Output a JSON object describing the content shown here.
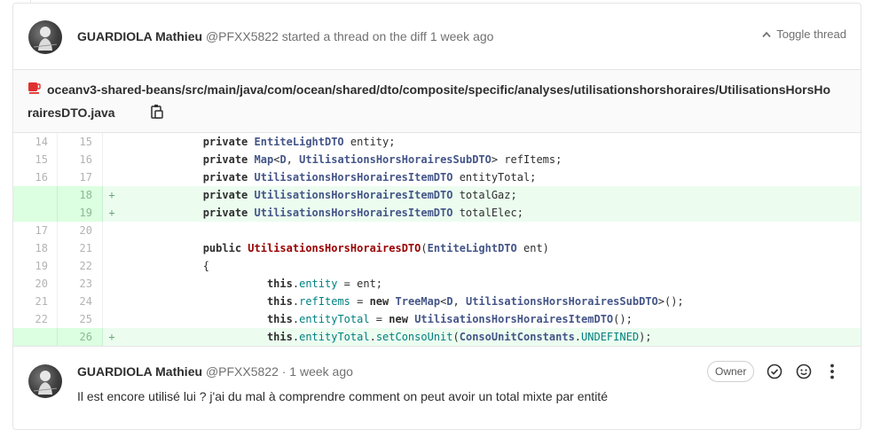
{
  "thread": {
    "author": "GUARDIOLA Mathieu",
    "handle": "@PFXX5822",
    "action_text": "started a thread on the diff 1 week ago",
    "toggle_label": "Toggle thread"
  },
  "file": {
    "path": "oceanv3-shared-beans/src/main/java/com/ocean/shared/dto/composite/specific/analyses/utilisationshorshoraires/UtilisationsHorsHorairesDTO.java",
    "icon": "java-file-icon",
    "copy_icon": "copy-to-clipboard-icon"
  },
  "diff_lines": [
    {
      "old": "14",
      "new": "15",
      "type": "context",
      "marker": ""
    },
    {
      "old": "15",
      "new": "16",
      "type": "context",
      "marker": ""
    },
    {
      "old": "16",
      "new": "17",
      "type": "context",
      "marker": ""
    },
    {
      "old": "",
      "new": "18",
      "type": "added",
      "marker": "+"
    },
    {
      "old": "",
      "new": "19",
      "type": "added",
      "marker": "+"
    },
    {
      "old": "17",
      "new": "20",
      "type": "context",
      "marker": ""
    },
    {
      "old": "18",
      "new": "21",
      "type": "context",
      "marker": ""
    },
    {
      "old": "19",
      "new": "22",
      "type": "context",
      "marker": ""
    },
    {
      "old": "20",
      "new": "23",
      "type": "context",
      "marker": ""
    },
    {
      "old": "21",
      "new": "24",
      "type": "context",
      "marker": ""
    },
    {
      "old": "22",
      "new": "25",
      "type": "context",
      "marker": ""
    },
    {
      "old": "",
      "new": "26",
      "type": "added",
      "marker": "+"
    }
  ],
  "code": [
    [
      [
        "            ",
        ""
      ],
      [
        "private",
        "kw"
      ],
      [
        " ",
        ""
      ],
      [
        "EntiteLightDTO",
        "ty"
      ],
      [
        " entity;",
        ""
      ]
    ],
    [
      [
        "            ",
        ""
      ],
      [
        "private",
        "kw"
      ],
      [
        " ",
        ""
      ],
      [
        "Map",
        "ty"
      ],
      [
        "<",
        ""
      ],
      [
        "D",
        "ty"
      ],
      [
        ", ",
        ""
      ],
      [
        "UtilisationsHorsHorairesSubDTO",
        "ty"
      ],
      [
        "> refItems;",
        ""
      ]
    ],
    [
      [
        "            ",
        ""
      ],
      [
        "private",
        "kw"
      ],
      [
        " ",
        ""
      ],
      [
        "UtilisationsHorsHorairesItemDTO",
        "ty"
      ],
      [
        " entityTotal;",
        ""
      ]
    ],
    [
      [
        "            ",
        ""
      ],
      [
        "private",
        "kw"
      ],
      [
        " ",
        ""
      ],
      [
        "UtilisationsHorsHorairesItemDTO",
        "ty"
      ],
      [
        " totalGaz;",
        ""
      ]
    ],
    [
      [
        "            ",
        ""
      ],
      [
        "private",
        "kw"
      ],
      [
        " ",
        ""
      ],
      [
        "UtilisationsHorsHorairesItemDTO",
        "ty"
      ],
      [
        " totalElec;",
        ""
      ]
    ],
    [
      [
        "",
        ""
      ]
    ],
    [
      [
        "            ",
        ""
      ],
      [
        "public",
        "kw"
      ],
      [
        " ",
        ""
      ],
      [
        "UtilisationsHorsHorairesDTO",
        "fn"
      ],
      [
        "(",
        ""
      ],
      [
        "EntiteLightDTO",
        "ty"
      ],
      [
        " ent)",
        ""
      ]
    ],
    [
      [
        "            {",
        ""
      ]
    ],
    [
      [
        "                      ",
        ""
      ],
      [
        "this",
        "kw"
      ],
      [
        ".",
        ""
      ],
      [
        "entity",
        "pr"
      ],
      [
        " = ent;",
        ""
      ]
    ],
    [
      [
        "                      ",
        ""
      ],
      [
        "this",
        "kw"
      ],
      [
        ".",
        ""
      ],
      [
        "refItems",
        "pr"
      ],
      [
        " = ",
        ""
      ],
      [
        "new",
        "kw"
      ],
      [
        " ",
        ""
      ],
      [
        "TreeMap",
        "ty"
      ],
      [
        "<",
        ""
      ],
      [
        "D",
        "ty"
      ],
      [
        ", ",
        ""
      ],
      [
        "UtilisationsHorsHorairesSubDTO",
        "ty"
      ],
      [
        ">();",
        ""
      ]
    ],
    [
      [
        "                      ",
        ""
      ],
      [
        "this",
        "kw"
      ],
      [
        ".",
        ""
      ],
      [
        "entityTotal",
        "pr"
      ],
      [
        " = ",
        ""
      ],
      [
        "new",
        "kw"
      ],
      [
        " ",
        ""
      ],
      [
        "UtilisationsHorsHorairesItemDTO",
        "ty"
      ],
      [
        "();",
        ""
      ]
    ],
    [
      [
        "                      ",
        ""
      ],
      [
        "this",
        "kw"
      ],
      [
        ".",
        ""
      ],
      [
        "entityTotal",
        "pr"
      ],
      [
        ".",
        ""
      ],
      [
        "setConsoUnit",
        "pr"
      ],
      [
        "(",
        ""
      ],
      [
        "ConsoUnitConstants",
        "ty"
      ],
      [
        ".",
        ""
      ],
      [
        "UNDEFINED",
        "pr"
      ],
      [
        ");",
        ""
      ]
    ]
  ],
  "comment": {
    "author": "GUARDIOLA Mathieu",
    "handle": "@PFXX5822",
    "time": "· 1 week ago",
    "role_badge": "Owner",
    "text": "Il est encore utilisé lui ? j'ai du mal à comprendre comment on peut avoir un total mixte par entité",
    "actions": [
      "resolve-check-icon",
      "emoji-smiley-icon",
      "more-actions-kebab-icon"
    ]
  }
}
